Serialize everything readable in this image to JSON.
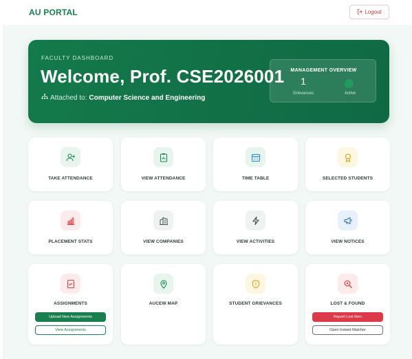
{
  "brand": {
    "part1": "AU",
    "part2": "PORTAL"
  },
  "header": {
    "logout_label": "Logout"
  },
  "hero": {
    "eyebrow": "FACULTY DASHBOARD",
    "welcome": "Welcome, Prof. CSE2026001",
    "attached_prefix": "Attached to:",
    "department": "Computer Science and Engineering",
    "overview": {
      "title": "MANAGEMENT OVERVIEW",
      "grievance_count": "1",
      "grievance_label": "Grievances",
      "active_label": "Active"
    }
  },
  "cards": {
    "take_attendance": "TAKE ATTENDANCE",
    "view_attendance": "VIEW ATTENDANCE",
    "time_table": "TIME TABLE",
    "selected_students": "SELECTED STUDENTS",
    "placement_stats": "PLACEMENT STATS",
    "view_companies": "VIEW COMPANIES",
    "view_activities": "VIEW ACTIVITIES",
    "view_notices": "VIEW NOTICES",
    "assignments": "ASSIGNMENTS",
    "upload_assignments": "Upload New Assignments",
    "view_assignments": "View Assignments",
    "aucew_map": "AUCEW MAP",
    "student_grievances": "STUDENT GRIEVANCES",
    "lost_found": "LOST & FOUND",
    "report_lost": "Report Lost Item",
    "instant_matcher": "Open Instant Matcher"
  },
  "colors": {
    "brand_green": "#15804f",
    "hero_green": "#137a4b",
    "logout_red": "#d23b3b",
    "report_red": "#dc3a48"
  }
}
